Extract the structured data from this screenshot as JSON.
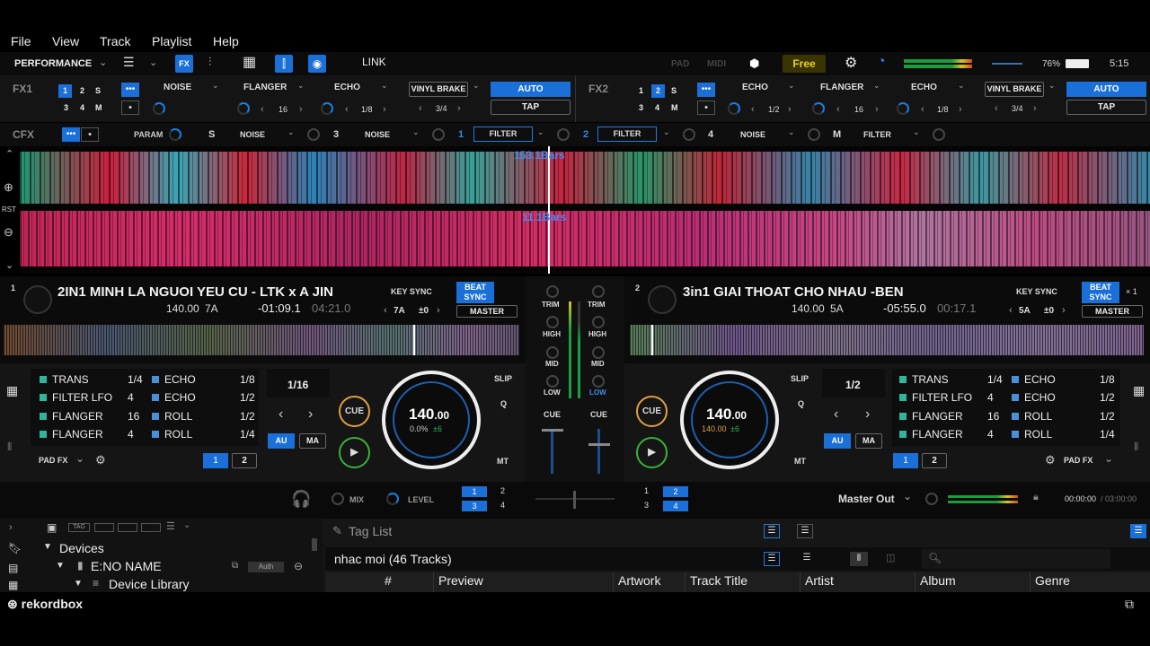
{
  "menu": [
    "File",
    "View",
    "Track",
    "Playlist",
    "Help"
  ],
  "topbar": {
    "mode": "PERFORMANCE",
    "link": "LINK",
    "pad": "PAD",
    "midi": "MIDI",
    "plan": "Free",
    "battery": "76%",
    "clock": "5:15",
    "fx_label": "FX"
  },
  "fx1": {
    "label": "FX1",
    "nums": [
      "1",
      "2",
      "S",
      "3",
      "4",
      "M"
    ],
    "slots": [
      "NOISE",
      "FLANGER",
      "ECHO"
    ],
    "vals": [
      "16",
      "1/8"
    ],
    "brake": "VINYL BRAKE",
    "brake_val": "3/4",
    "auto": "AUTO",
    "tap": "TAP"
  },
  "fx2": {
    "label": "FX2",
    "nums": [
      "1",
      "2",
      "S",
      "3",
      "4",
      "M"
    ],
    "slots": [
      "ECHO",
      "FLANGER",
      "ECHO"
    ],
    "vals": [
      "1/2",
      "16",
      "1/8"
    ],
    "brake": "VINYL BRAKE",
    "brake_val": "3/4",
    "auto": "AUTO",
    "tap": "TAP"
  },
  "cfx": {
    "label": "CFX",
    "param": "PARAM",
    "items": [
      {
        "k": "S",
        "v": "NOISE"
      },
      {
        "k": "3",
        "v": "NOISE"
      },
      {
        "k": "1",
        "v": "FILTER"
      },
      {
        "k": "2",
        "v": "FILTER"
      },
      {
        "k": "4",
        "v": "NOISE"
      },
      {
        "k": "M",
        "v": "FILTER"
      }
    ]
  },
  "wave": {
    "bars1": "153.1Bars",
    "bars2": "11.1Bars",
    "rst": "RST"
  },
  "deck1": {
    "num": "1",
    "title": "2IN1 MINH LA NGUOI YEU CU - LTK x A JIN",
    "bpm": "140.00",
    "key": "7A",
    "remain": "-01:09.1",
    "total": "04:21.0",
    "keysync": "KEY SYNC",
    "beat": "BEAT",
    "sync": "SYNC",
    "keyval": "7A",
    "pm": "±0",
    "master": "MASTER",
    "pads": [
      {
        "n": "TRANS",
        "v": "1/4",
        "c": "#2fb59a"
      },
      {
        "n": "FILTER LFO",
        "v": "4",
        "c": "#2fb59a"
      },
      {
        "n": "FLANGER",
        "v": "16",
        "c": "#2fb59a"
      },
      {
        "n": "FLANGER",
        "v": "4",
        "c": "#2fb59a"
      }
    ],
    "pads2": [
      {
        "n": "ECHO",
        "v": "1/8",
        "c": "#4a90d9"
      },
      {
        "n": "ECHO",
        "v": "1/2",
        "c": "#4a90d9"
      },
      {
        "n": "ROLL",
        "v": "1/2",
        "c": "#4a90d9"
      },
      {
        "n": "ROLL",
        "v": "1/4",
        "c": "#4a90d9"
      }
    ],
    "beatjump": "1/16",
    "au": "AU",
    "ma": "MA",
    "cue": "CUE",
    "slip": "SLIP",
    "q": "Q",
    "mt": "MT",
    "jog_bpm": "140",
    "jog_dec": ".00",
    "jog_pct": "0.0%",
    "jog_range": "±6",
    "padfx": "PAD FX",
    "b1": "1",
    "b2": "2"
  },
  "deck2": {
    "num": "2",
    "title": "3in1 GIAI THOAT CHO NHAU -BEN",
    "bpm": "140.00",
    "key": "5A",
    "remain": "-05:55.0",
    "total": "00:17.1",
    "keysync": "KEY SYNC",
    "beat": "BEAT",
    "sync": "SYNC",
    "x1": "× 1",
    "keyval": "5A",
    "pm": "±0",
    "master": "MASTER",
    "pads": [
      {
        "n": "TRANS",
        "v": "1/4",
        "c": "#2fb59a"
      },
      {
        "n": "FILTER LFO",
        "v": "4",
        "c": "#2fb59a"
      },
      {
        "n": "FLANGER",
        "v": "16",
        "c": "#2fb59a"
      },
      {
        "n": "FLANGER",
        "v": "4",
        "c": "#2fb59a"
      }
    ],
    "pads2": [
      {
        "n": "ECHO",
        "v": "1/8",
        "c": "#4a90d9"
      },
      {
        "n": "ECHO",
        "v": "1/2",
        "c": "#4a90d9"
      },
      {
        "n": "ROLL",
        "v": "1/2",
        "c": "#4a90d9"
      },
      {
        "n": "ROLL",
        "v": "1/4",
        "c": "#4a90d9"
      }
    ],
    "beatjump": "1/2",
    "au": "AU",
    "ma": "MA",
    "cue": "CUE",
    "slip": "SLIP",
    "q": "Q",
    "mt": "MT",
    "jog_bpm": "140",
    "jog_dec": ".00",
    "jog_pct": "140.00",
    "jog_range": "±6",
    "padfx": "PAD FX",
    "b1": "1",
    "b2": "2"
  },
  "mixer": {
    "trim": "TRIM",
    "high": "HIGH",
    "mid": "MID",
    "low": "LOW",
    "cue": "CUE"
  },
  "bottom": {
    "mix": "MIX",
    "level": "LEVEL",
    "master_out": "Master Out",
    "time": "00:00:00",
    "time_total": "03:00:00",
    "n": [
      "1",
      "2",
      "3",
      "4"
    ]
  },
  "browser": {
    "tag": "TAG",
    "devices": "Devices",
    "drive": "E:NO NAME",
    "auth": "Auth",
    "library": "Device Library",
    "taglist": "Tag List",
    "playlist": "nhac moi (46 Tracks)",
    "cols": [
      "#",
      "Preview",
      "Artwork",
      "Track Title",
      "Artist",
      "Album",
      "Genre"
    ]
  },
  "footer": {
    "logo": "rekordbox"
  }
}
